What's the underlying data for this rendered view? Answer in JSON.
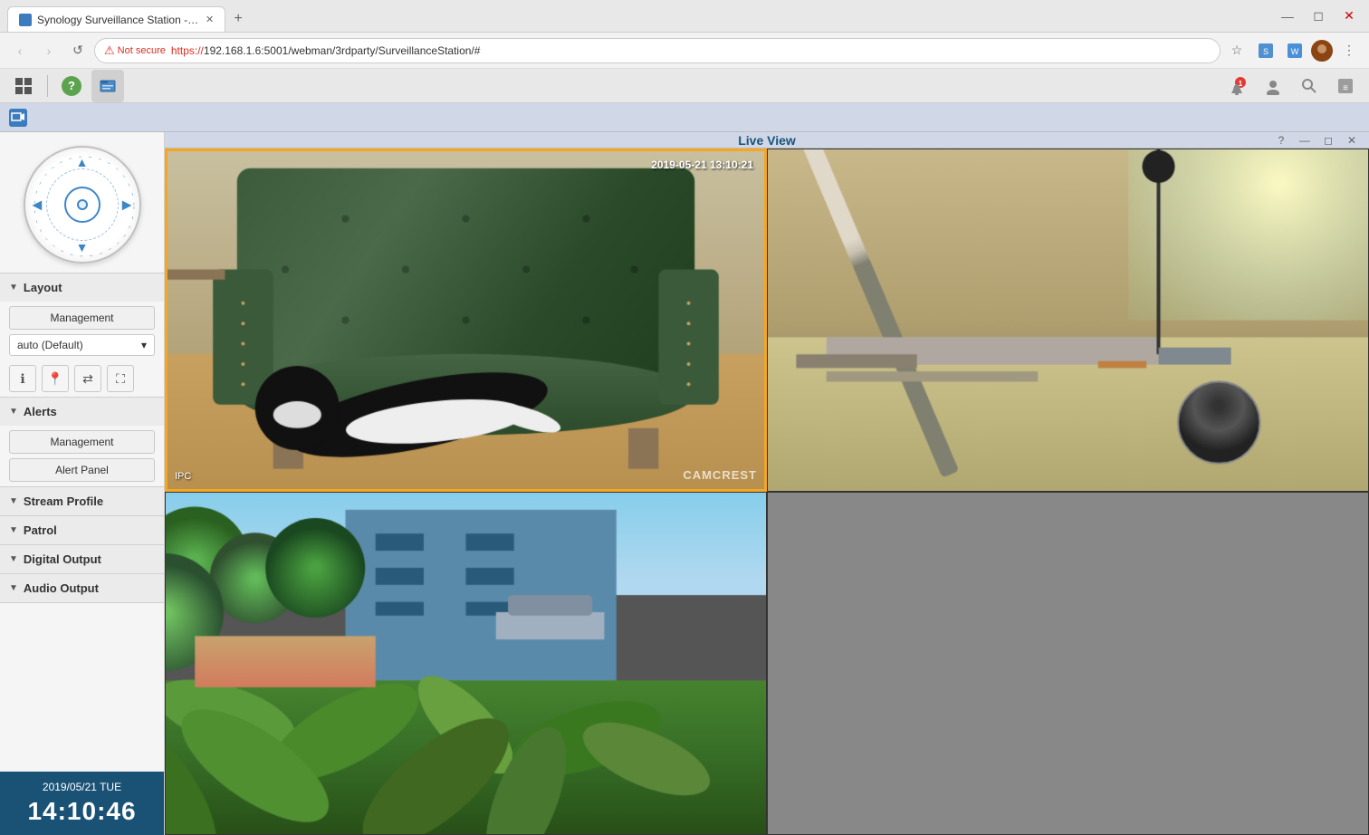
{
  "browser": {
    "tab_label": "Synology Surveillance Station - R...",
    "tab_favicon": "●",
    "url_protocol": "https://",
    "url_domain": "192.168.1.6",
    "url_port": ":5001",
    "url_path": "/webman/3rdparty/SurveillanceStation/#",
    "secure_warning": "Not secure",
    "new_tab_icon": "+"
  },
  "toolbar": {
    "apps_icon": "⊞",
    "help_icon": "?",
    "file_manager_icon": "🖥"
  },
  "app": {
    "title": "Live View",
    "icon": "📹"
  },
  "sidebar": {
    "layout_label": "Layout",
    "management_btn": "Management",
    "dropdown_value": "auto (Default)",
    "alerts_label": "Alerts",
    "alerts_management_btn": "Management",
    "alert_panel_btn": "Alert Panel",
    "stream_profile_label": "Stream Profile",
    "patrol_label": "Patrol",
    "digital_output_label": "Digital Output",
    "audio_output_label": "Audio Output"
  },
  "clock": {
    "date": "2019/05/21  TUE",
    "time": "14:10:46"
  },
  "cameras": [
    {
      "id": 1,
      "timestamp": "2019-05-21 13:10:21",
      "label": "IPC",
      "watermark": "CAMCREST",
      "selected": true,
      "type": "cat_chair"
    },
    {
      "id": 2,
      "timestamp": "",
      "label": "",
      "watermark": "",
      "selected": false,
      "type": "desk"
    },
    {
      "id": 3,
      "timestamp": "",
      "label": "",
      "watermark": "",
      "selected": false,
      "type": "garden"
    },
    {
      "id": 4,
      "timestamp": "",
      "label": "",
      "watermark": "",
      "selected": false,
      "type": "empty"
    }
  ],
  "ptz": {
    "up_arrow": "▲",
    "down_arrow": "▼",
    "left_arrow": "◀",
    "right_arrow": "▶"
  },
  "main_controls": {
    "question_icon": "?",
    "minimize_icon": "—",
    "restore_icon": "◻",
    "close_icon": "✕"
  }
}
